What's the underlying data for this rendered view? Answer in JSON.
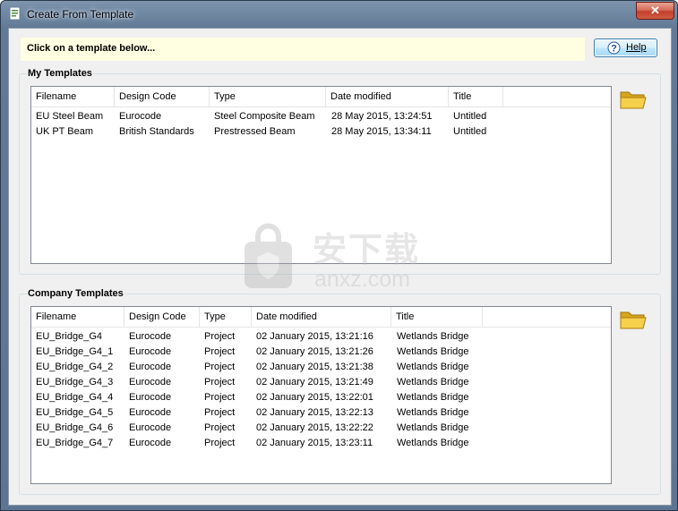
{
  "window": {
    "title": "Create From Template",
    "close_label": "✕"
  },
  "hint": "Click on a template below...",
  "help_button": {
    "label": "Help",
    "icon": "help-icon"
  },
  "my_templates": {
    "title": "My Templates",
    "columns": [
      "Filename",
      "Design Code",
      "Type",
      "Date modified",
      "Title"
    ],
    "rows": [
      [
        "EU Steel Beam",
        "Eurocode",
        "Steel Composite Beam",
        "28 May 2015, 13:24:51",
        "Untitled"
      ],
      [
        "UK PT Beam",
        "British Standards",
        "Prestressed Beam",
        "28 May 2015, 13:34:11",
        "Untitled"
      ]
    ],
    "folder_icon": "open-folder-icon"
  },
  "company_templates": {
    "title": "Company Templates",
    "columns": [
      "Filename",
      "Design Code",
      "Type",
      "Date modified",
      "Title"
    ],
    "rows": [
      [
        "EU_Bridge_G4",
        "Eurocode",
        "Project",
        "02 January 2015, 13:21:16",
        "Wetlands Bridge"
      ],
      [
        "EU_Bridge_G4_1",
        "Eurocode",
        "Project",
        "02 January 2015, 13:21:26",
        "Wetlands Bridge"
      ],
      [
        "EU_Bridge_G4_2",
        "Eurocode",
        "Project",
        "02 January 2015, 13:21:38",
        "Wetlands Bridge"
      ],
      [
        "EU_Bridge_G4_3",
        "Eurocode",
        "Project",
        "02 January 2015, 13:21:49",
        "Wetlands Bridge"
      ],
      [
        "EU_Bridge_G4_4",
        "Eurocode",
        "Project",
        "02 January 2015, 13:22:01",
        "Wetlands Bridge"
      ],
      [
        "EU_Bridge_G4_5",
        "Eurocode",
        "Project",
        "02 January 2015, 13:22:13",
        "Wetlands Bridge"
      ],
      [
        "EU_Bridge_G4_6",
        "Eurocode",
        "Project",
        "02 January 2015, 13:22:22",
        "Wetlands Bridge"
      ],
      [
        "EU_Bridge_G4_7",
        "Eurocode",
        "Project",
        "02 January 2015, 13:23:11",
        "Wetlands Bridge"
      ]
    ],
    "folder_icon": "open-folder-icon"
  },
  "watermark": {
    "cn": "安下载",
    "en": "anxz.com"
  }
}
